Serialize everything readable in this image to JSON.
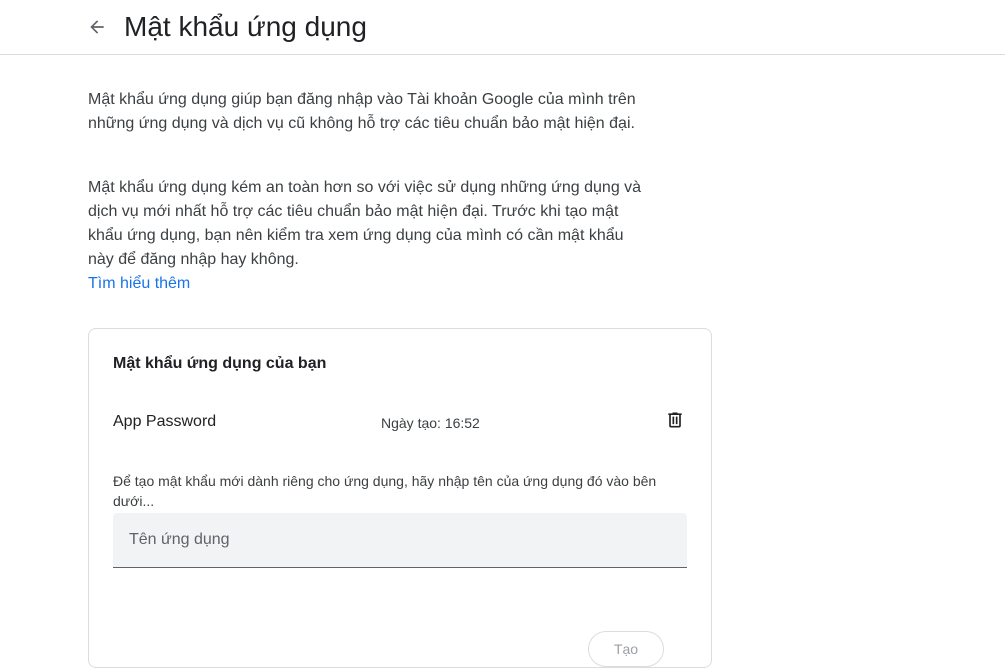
{
  "header": {
    "title": "Mật khẩu ứng dụng",
    "back_icon": "arrow-back-icon"
  },
  "intro": {
    "paragraph_1": "Mật khẩu ứng dụng giúp bạn đăng nhập vào Tài khoản Google của mình trên những ứng dụng và dịch vụ cũ không hỗ trợ các tiêu chuẩn bảo mật hiện đại.",
    "paragraph_2": "Mật khẩu ứng dụng kém an toàn hơn so với việc sử dụng những ứng dụng và dịch vụ mới nhất hỗ trợ các tiêu chuẩn bảo mật hiện đại. Trước khi tạo mật khẩu ứng dụng, bạn nên kiểm tra xem ứng dụng của mình có cần mật khẩu này để đăng nhập hay không.",
    "learn_more": "Tìm hiểu thêm"
  },
  "card": {
    "title": "Mật khẩu ứng dụng của bạn",
    "passwords": [
      {
        "name": "App Password",
        "created": "Ngày tạo: 16:52",
        "delete_icon": "trash-icon"
      }
    ],
    "instructions": "Để tạo mật khẩu mới dành riêng cho ứng dụng, hãy nhập tên của ứng dụng đó vào bên dưới...",
    "input_placeholder": "Tên ứng dụng",
    "input_value": "",
    "create_label": "Tạo"
  },
  "colors": {
    "link": "#1a73e8",
    "divider": "#dadce0",
    "input_bg": "#f1f3f4"
  }
}
